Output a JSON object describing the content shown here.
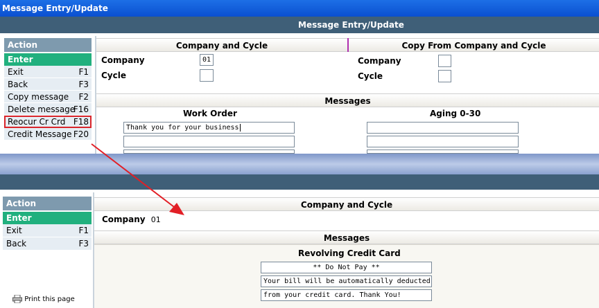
{
  "window_title": "Message Entry/Update",
  "page_title": "Message Entry/Update",
  "top": {
    "action_header": "Action",
    "enter_label": "Enter",
    "menu": [
      {
        "label": "Exit",
        "key": "F1"
      },
      {
        "label": "Back",
        "key": "F3"
      },
      {
        "label": "Copy message",
        "key": "F2"
      },
      {
        "label": "Delete message",
        "key": "F16"
      },
      {
        "label": "Reocur Cr Crd",
        "key": "F18"
      },
      {
        "label": "Credit Message",
        "key": "F20"
      }
    ],
    "company_cycle_title": "Company and Cycle",
    "copy_from_title": "Copy From Company and Cycle",
    "company_label": "Company",
    "company_value": "01",
    "cycle_label": "Cycle",
    "copy_company_label": "Company",
    "copy_cycle_label": "Cycle",
    "messages_title": "Messages",
    "work_order_title": "Work Order",
    "aging_title": "Aging 0-30",
    "work_order_line1": "Thank you for your business"
  },
  "bottom": {
    "action_header": "Action",
    "enter_label": "Enter",
    "menu": [
      {
        "label": "Exit",
        "key": "F1"
      },
      {
        "label": "Back",
        "key": "F3"
      }
    ],
    "company_cycle_title": "Company and Cycle",
    "company_label": "Company",
    "company_value": "01",
    "messages_title": "Messages",
    "revolving_title": "Revolving Credit Card",
    "lines": [
      "** Do Not Pay **",
      "Your bill will be automatically deducted",
      "from your credit card. Thank You!"
    ],
    "print_label": "Print this page"
  },
  "colors": {
    "title_blue": "#0a4fd0",
    "header_slate": "#3f5f78",
    "action_gray": "#7e9aae",
    "enter_green": "#21b07e",
    "highlight_red": "#d9252b"
  }
}
